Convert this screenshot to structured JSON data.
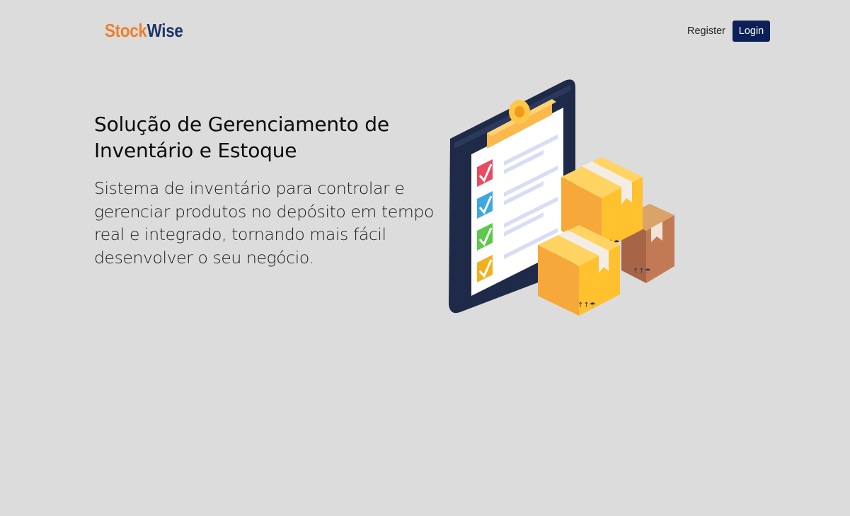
{
  "header": {
    "logo_part1": "Stock",
    "logo_part2": "Wise",
    "register_label": "Register",
    "login_label": "Login"
  },
  "hero": {
    "title": "Solução de Gerenciamento de Inventário e Estoque",
    "description": "Sistema de inventário para controlar e gerenciar produtos no depósito em tempo real e integrado, tornando mais fácil desenvolver o seu negócio."
  },
  "colors": {
    "background": "#dcdcdc",
    "logo_orange": "#ee7e2c",
    "logo_navy": "#1f3466",
    "login_button": "#0d1f57"
  },
  "illustration": {
    "icon": "clipboard-boxes-illustration",
    "checkbox_colors": [
      "#e84a5f",
      "#3fa7e0",
      "#5cc94a",
      "#f2b01e"
    ]
  }
}
